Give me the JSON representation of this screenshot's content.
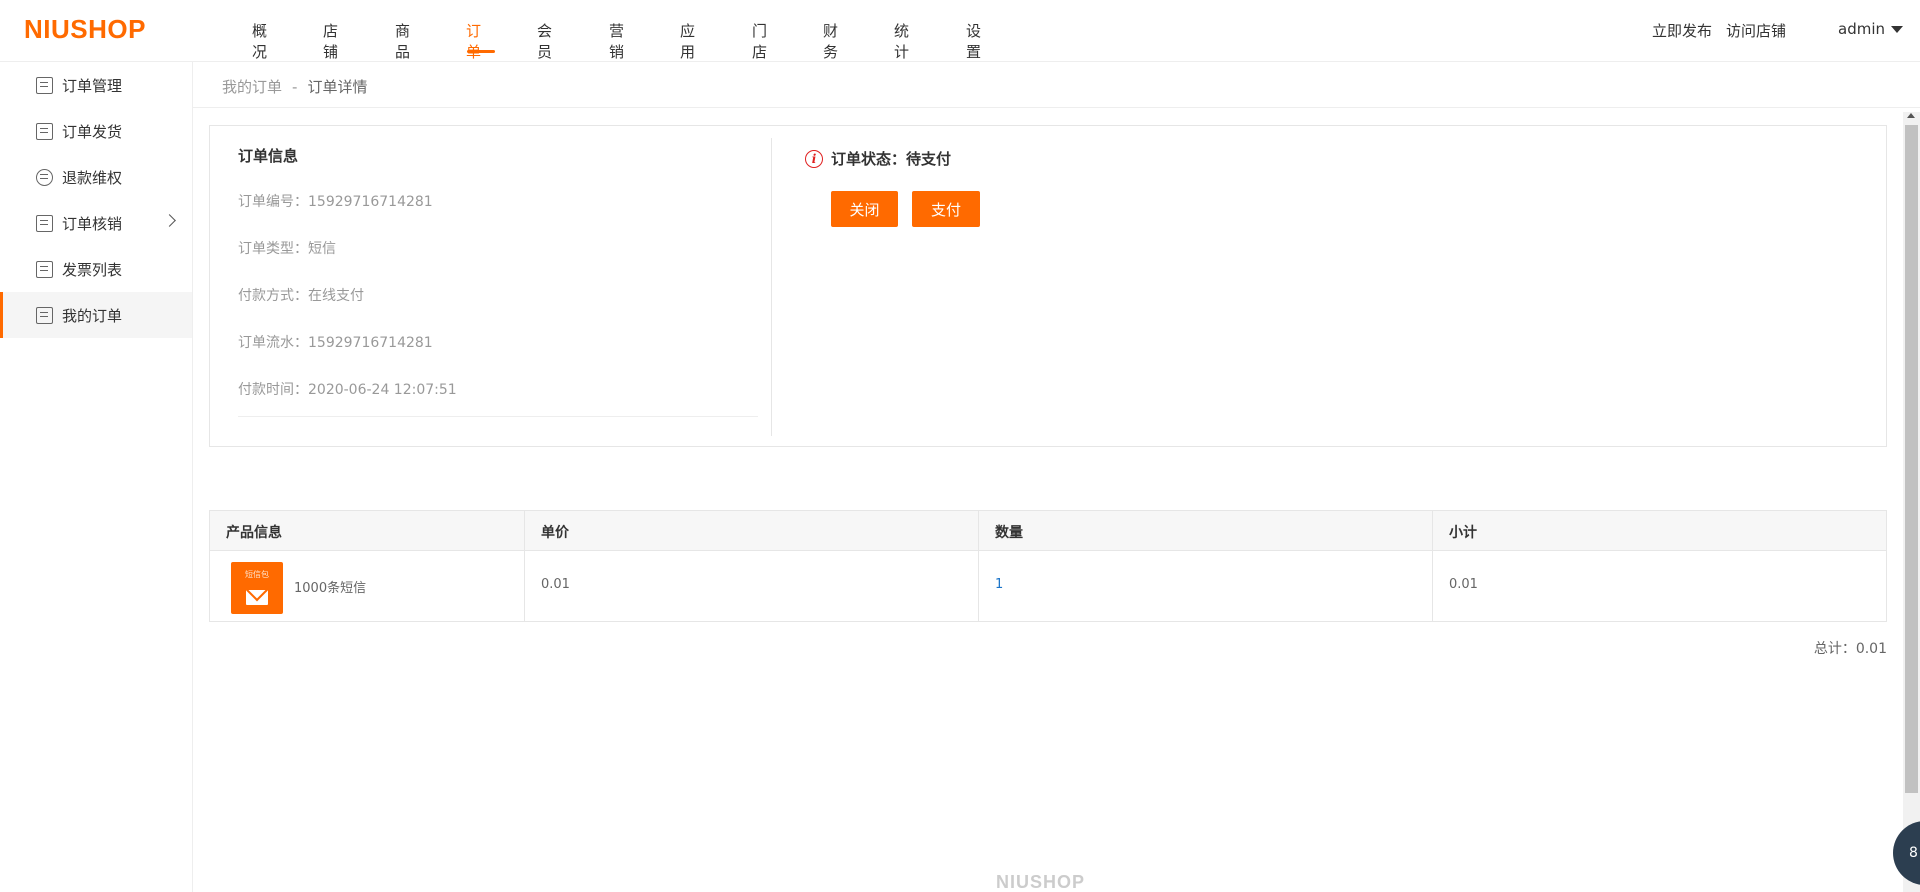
{
  "brand": {
    "logo": "NIUSHOP",
    "accent": "#ff6a00"
  },
  "topnav": {
    "items": [
      "概况",
      "店铺",
      "商品",
      "订单",
      "会员",
      "营销",
      "应用",
      "门店",
      "财务",
      "统计",
      "设置"
    ],
    "active": "订单"
  },
  "header": {
    "publish": "立即发布",
    "visit": "访问店铺",
    "user": "admin"
  },
  "sidebar": {
    "items": [
      {
        "label": "订单管理",
        "icon": "order-list-icon"
      },
      {
        "label": "订单发货",
        "icon": "delivery-icon"
      },
      {
        "label": "退款维权",
        "icon": "refund-icon"
      },
      {
        "label": "订单核销",
        "icon": "verify-icon"
      },
      {
        "label": "发票列表",
        "icon": "invoice-icon"
      },
      {
        "label": "我的订单",
        "icon": "my-order-icon"
      }
    ]
  },
  "breadcrumb": {
    "parent": "我的订单",
    "separator": "-",
    "current": "订单详情"
  },
  "order_info": {
    "title": "订单信息",
    "rows": [
      {
        "label": "订单编号：",
        "value": "15929716714281"
      },
      {
        "label": "订单类型：",
        "value": "短信"
      },
      {
        "label": "付款方式：",
        "value": "在线支付"
      },
      {
        "label": "订单流水：",
        "value": "15929716714281"
      },
      {
        "label": "付款时间：",
        "value": "2020-06-24 12:07:51"
      }
    ]
  },
  "status": {
    "label": "订单状态：待支付",
    "close_btn": "关闭",
    "pay_btn": "支付",
    "warn_color": "#e02020"
  },
  "product_table": {
    "headers": [
      "产品信息",
      "单价",
      "数量",
      "小计"
    ],
    "rows": [
      {
        "thumb_text": "短信包",
        "name": "1000条短信",
        "price": "0.01",
        "qty": "1",
        "subtotal": "0.01"
      }
    ]
  },
  "total": "总计：0.01",
  "footer": {
    "logo": "NIUSHOP"
  },
  "float_button": {
    "label": "8"
  }
}
